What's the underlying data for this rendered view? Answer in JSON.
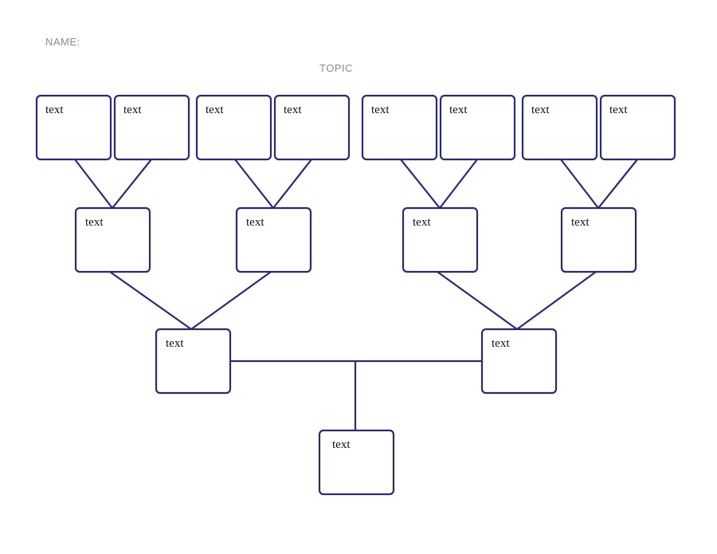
{
  "header": {
    "name_label": "NAME:",
    "topic_label": "TOPIC"
  },
  "colors": {
    "stroke": "#2b2b6b",
    "header_text": "#8a8a8a"
  },
  "diagram": {
    "type": "tree",
    "levels": [
      {
        "level": 1,
        "nodes": [
          "text",
          "text",
          "text",
          "text",
          "text",
          "text",
          "text",
          "text"
        ]
      },
      {
        "level": 2,
        "nodes": [
          "text",
          "text",
          "text",
          "text"
        ]
      },
      {
        "level": 3,
        "nodes": [
          "text",
          "text"
        ]
      },
      {
        "level": 4,
        "nodes": [
          "text"
        ]
      }
    ]
  }
}
